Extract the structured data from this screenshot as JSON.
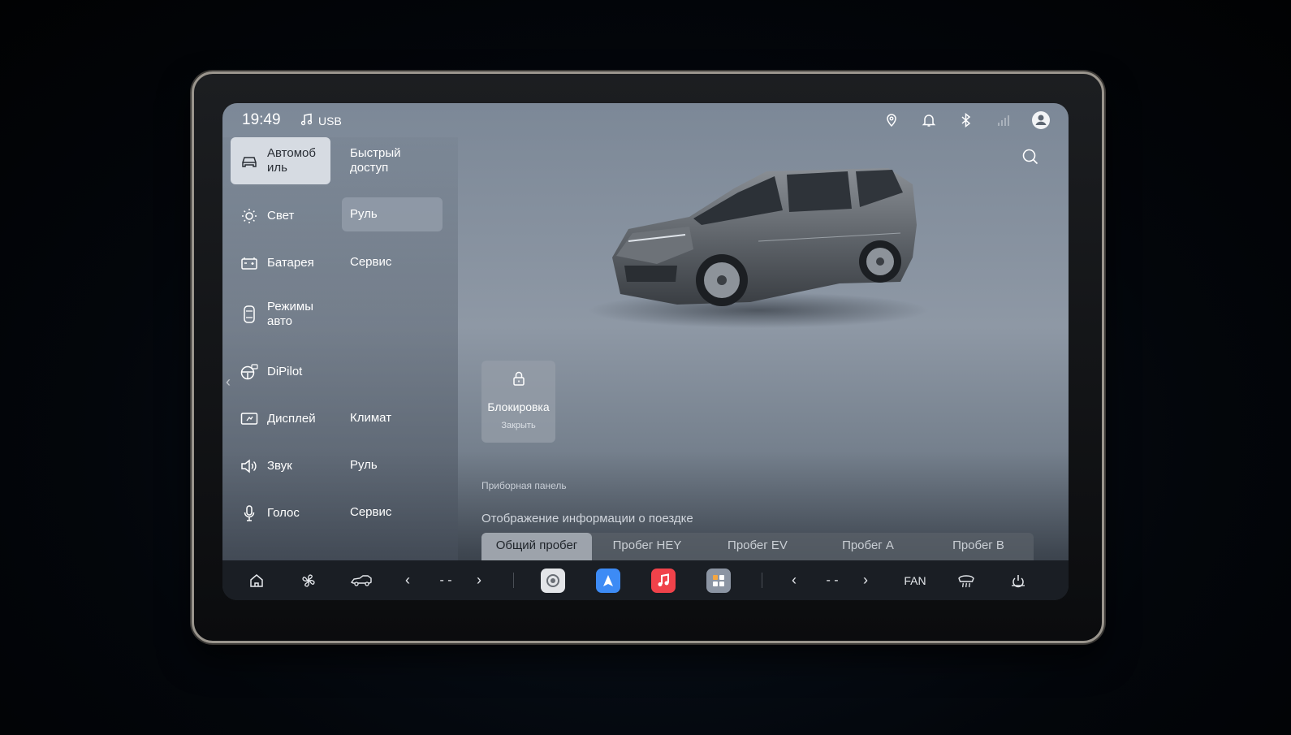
{
  "status_bar": {
    "time": "19:49",
    "media_source": "USB",
    "icons": [
      "location-pin-icon",
      "bell-icon",
      "bluetooth-icon",
      "signal-icon",
      "profile-icon"
    ]
  },
  "menu": {
    "items": [
      {
        "label": "Автомоб\nиль",
        "icon": "car-icon",
        "active": true
      },
      {
        "label": "Свет",
        "icon": "sun-icon"
      },
      {
        "label": "Батарея",
        "icon": "battery-icon"
      },
      {
        "label": "Режимы\nавто",
        "icon": "car-top-icon"
      },
      {
        "label": "DiPilot",
        "icon": "steering-wheel-icon"
      },
      {
        "label": "Дисплей",
        "icon": "display-icon"
      },
      {
        "label": "Звук",
        "icon": "speaker-icon"
      },
      {
        "label": "Голос",
        "icon": "microphone-icon"
      }
    ]
  },
  "submenu": {
    "items": [
      {
        "label": "Быстрый\nдоступ"
      },
      {
        "label": "Руль",
        "active": true
      },
      {
        "label": "Сервис"
      },
      {
        "label": "Климат"
      },
      {
        "label": "Руль"
      },
      {
        "label": "Сервис"
      }
    ]
  },
  "main": {
    "lock_card": {
      "title": "Блокировка",
      "subtitle": "Закрыть",
      "icon": "lock-icon"
    },
    "section_caption": "Приборная панель",
    "trip_title": "Отображение информации о поездке",
    "tabs": [
      {
        "label": "Общий пробег",
        "active": true
      },
      {
        "label": "Пробег HEY"
      },
      {
        "label": "Пробег EV"
      },
      {
        "label": "Пробег A"
      },
      {
        "label": "Пробег B"
      }
    ]
  },
  "dock": {
    "left_temp": "- -",
    "right_temp": "- -",
    "fan_label": "FAN",
    "icons": [
      "home-icon",
      "fan-icon",
      "car-side-icon",
      "settings-app-icon",
      "navigation-app-icon",
      "music-app-icon",
      "apps-icon",
      "defrost-icon",
      "power-icon"
    ]
  },
  "colors": {
    "accent_music": "#f0424a",
    "accent_nav": "#3d8bf5",
    "dock_bg": "#1a1e24"
  }
}
